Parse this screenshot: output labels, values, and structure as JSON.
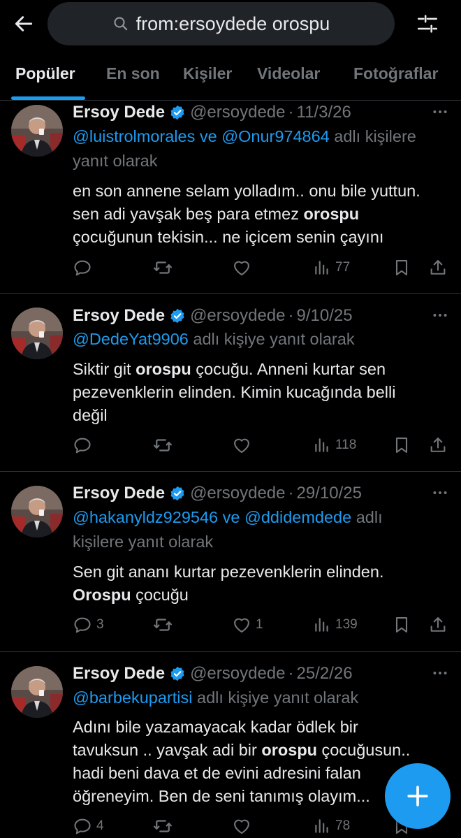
{
  "search": {
    "query": "from:ersoydede orospu"
  },
  "tabs": [
    {
      "label": "Popüler",
      "active": true
    },
    {
      "label": "En son"
    },
    {
      "label": "Kişiler"
    },
    {
      "label": "Videolar"
    },
    {
      "label": "Fotoğraflar"
    }
  ],
  "tweets": [
    {
      "name": "Ersoy Dede",
      "handle": "@ersoydede",
      "separator": "·",
      "date": "11/3/26",
      "reply_mentions": [
        "@luistrolmorales",
        "ve",
        "@Onur974864"
      ],
      "reply_suffix_1": "adlı kişilere",
      "reply_suffix_2": "yanıt olarak",
      "lines": [
        {
          "pre": "en son annene selam yolladım.. onu bile yuttun."
        },
        {
          "pre": "sen adi yavşak beş para etmez ",
          "kw": "orospu",
          "post": ""
        },
        {
          "pre": "çocuğunun tekisin... ne içicem senin çayını"
        }
      ],
      "stats": {
        "replies": "",
        "retweets": "",
        "likes": "",
        "views": "77"
      }
    },
    {
      "name": "Ersoy Dede",
      "handle": "@ersoydede",
      "separator": "·",
      "date": "9/10/25",
      "reply_mentions": [
        "@DedeYat9906"
      ],
      "reply_suffix_1": "adlı kişiye yanıt olarak",
      "lines": [
        {
          "pre": "Siktir git ",
          "kw": "orospu",
          "post": " çocuğu. Anneni kurtar sen"
        },
        {
          "pre": "pezevenklerin elinden. Kimin kucağında belli"
        },
        {
          "pre": "değil"
        }
      ],
      "stats": {
        "replies": "",
        "retweets": "",
        "likes": "",
        "views": "118"
      }
    },
    {
      "name": "Ersoy Dede",
      "handle": "@ersoydede",
      "separator": "·",
      "date": "29/10/25",
      "reply_mentions": [
        "@hakanyldz929546",
        "ve",
        "@ddidemdede"
      ],
      "reply_suffix_1": "adlı",
      "reply_suffix_2": "kişilere yanıt olarak",
      "lines": [
        {
          "pre": "Sen git ananı kurtar pezevenklerin elinden."
        },
        {
          "pre": "",
          "kw": "Orospu",
          "post": " çocuğu"
        }
      ],
      "stats": {
        "replies": "3",
        "retweets": "",
        "likes": "1",
        "views": "139"
      }
    },
    {
      "name": "Ersoy Dede",
      "handle": "@ersoydede",
      "separator": "·",
      "date": "25/2/26",
      "reply_mentions": [
        "@barbekupartisi"
      ],
      "reply_suffix_1": "adlı kişiye yanıt olarak",
      "lines": [
        {
          "pre": "Adını bile yazamayacak kadar ödlek bir"
        },
        {
          "pre": "tavuksun .. yavşak adi bir ",
          "kw": "orospu",
          "post": " çocuğusun.."
        },
        {
          "pre": "hadi beni dava et de evini adresini falan"
        },
        {
          "pre": "öğreneyim. Ben de seni tanımış olayım..."
        }
      ],
      "stats": {
        "replies": "4",
        "retweets": "",
        "likes": "",
        "views": "78"
      }
    }
  ],
  "icons": {
    "back": "arrow-left-icon",
    "search": "search-icon",
    "filter": "sliders-icon",
    "verified": "verified-badge-icon",
    "more": "more-dots-icon",
    "reply": "reply-icon",
    "retweet": "retweet-icon",
    "like": "heart-icon",
    "views": "views-icon",
    "bookmark": "bookmark-icon",
    "share": "share-icon",
    "compose": "plus-icon"
  },
  "colors": {
    "accent": "#1d9bf0",
    "muted": "#71767b",
    "text": "#e7e9ea",
    "background": "#000000"
  }
}
